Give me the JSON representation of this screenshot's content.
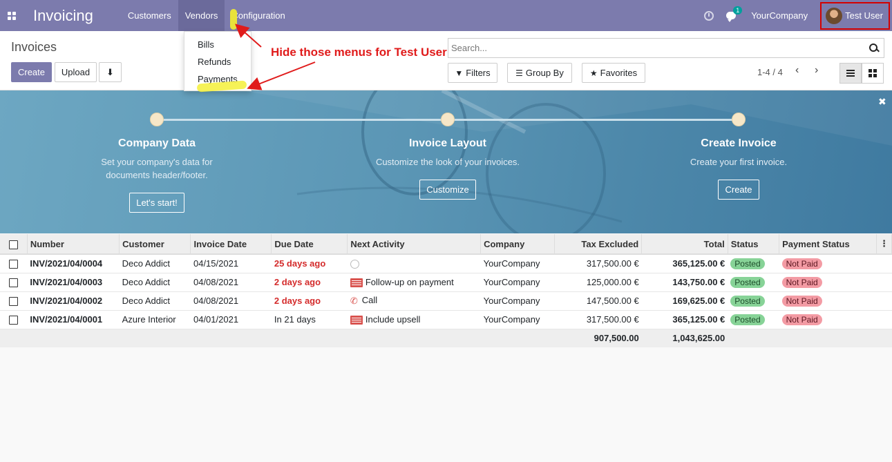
{
  "app": {
    "title": "Invoicing"
  },
  "nav": {
    "menus": [
      "Customers",
      "Vendors",
      "Configuration"
    ],
    "company": "YourCompany",
    "user": "Test User",
    "chat_count": "1"
  },
  "vendors_menu": {
    "items": [
      "Bills",
      "Refunds",
      "Payments"
    ]
  },
  "annotation": {
    "text": "Hide those menus for Test User",
    "color": "#e01b1b"
  },
  "control": {
    "breadcrumb": "Invoices",
    "create": "Create",
    "upload": "Upload",
    "search_placeholder": "Search...",
    "filters": "Filters",
    "group_by": "Group By",
    "favorites": "Favorites",
    "pager": "1-4 / 4"
  },
  "banner": {
    "steps": [
      {
        "title": "Company Data",
        "desc1": "Set your company's data for",
        "desc2": "documents header/footer.",
        "button": "Let's start!"
      },
      {
        "title": "Invoice Layout",
        "desc1": "Customize the look of your invoices.",
        "desc2": "",
        "button": "Customize"
      },
      {
        "title": "Create Invoice",
        "desc1": "Create your first invoice.",
        "desc2": "",
        "button": "Create"
      }
    ]
  },
  "table": {
    "headers": [
      "Number",
      "Customer",
      "Invoice Date",
      "Due Date",
      "Next Activity",
      "Company",
      "Tax Excluded",
      "Total",
      "Status",
      "Payment Status"
    ],
    "rows": [
      {
        "number": "INV/2021/04/0004",
        "customer": "Deco Addict",
        "invoice_date": "04/15/2021",
        "due_date": "25 days ago",
        "activity": "",
        "company": "YourCompany",
        "tax_excluded": "317,500.00 €",
        "total": "365,125.00 €",
        "status": "Posted",
        "payment_status": "Not Paid"
      },
      {
        "number": "INV/2021/04/0003",
        "customer": "Deco Addict",
        "invoice_date": "04/08/2021",
        "due_date": "2 days ago",
        "activity": "Follow-up on payment",
        "company": "YourCompany",
        "tax_excluded": "125,000.00 €",
        "total": "143,750.00 €",
        "status": "Posted",
        "payment_status": "Not Paid"
      },
      {
        "number": "INV/2021/04/0002",
        "customer": "Deco Addict",
        "invoice_date": "04/08/2021",
        "due_date": "2 days ago",
        "activity": "Call",
        "company": "YourCompany",
        "tax_excluded": "147,500.00 €",
        "total": "169,625.00 €",
        "status": "Posted",
        "payment_status": "Not Paid"
      },
      {
        "number": "INV/2021/04/0001",
        "customer": "Azure Interior",
        "invoice_date": "04/01/2021",
        "due_date": "In 21 days",
        "activity": "Include upsell",
        "company": "YourCompany",
        "tax_excluded": "317,500.00 €",
        "total": "365,125.00 €",
        "status": "Posted",
        "payment_status": "Not Paid"
      }
    ],
    "totals": {
      "tax_excluded": "907,500.00",
      "total": "1,043,625.00"
    }
  },
  "colors": {
    "navbar": "#7c7bad",
    "primary": "#7c7bad",
    "overdue": "#d42b2b",
    "posted": "#87d397",
    "not_paid": "#f39ba4"
  }
}
